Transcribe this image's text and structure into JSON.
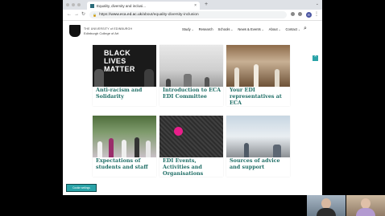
{
  "browser": {
    "tab_title": "Equality, diversity and inclusi...",
    "tab_close": "×",
    "new_tab": "+",
    "url_host": "www.eca.ed.ac.uk",
    "url_prefix": "https://",
    "url_path": "/about/equality-diversity-inclusion",
    "profile_initial": "R"
  },
  "site": {
    "university": "THE UNIVERSITY of EDINBURGH",
    "college": "Edinburgh College of Art",
    "nav": [
      "Study",
      "Research",
      "Schools",
      "News & Events",
      "About",
      "Contact"
    ],
    "search_icon": "search-icon",
    "back_to_top": "^"
  },
  "cards": [
    {
      "title": "Anti-racism and Solidarity",
      "image": "black-lives-matter-protest",
      "image_text": [
        "BLACK",
        "LIVES",
        "MATTER"
      ]
    },
    {
      "title": "Introduction to ECA EDI Committee",
      "image": "gallery-room"
    },
    {
      "title": "Your EDI representatives at ECA",
      "image": "sculpture-court"
    },
    {
      "title": "Expectations of students and staff",
      "image": "graduation-group"
    },
    {
      "title": "EDI Events, Activities and Organisations",
      "image": "pink-dot-pattern"
    },
    {
      "title": "Sources of advice and support",
      "image": "study-space"
    }
  ],
  "cookie_button": "Cookie settings",
  "colors": {
    "accent": "#2aa3a8",
    "title_green": "#1f6e66",
    "pink": "#e91e8a"
  }
}
